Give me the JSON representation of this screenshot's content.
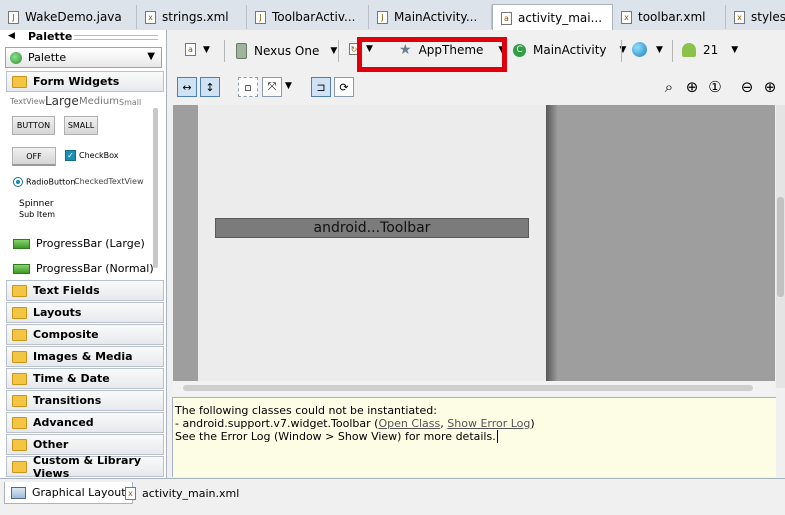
{
  "editor_tabs": [
    {
      "label": "WakeDemo.java",
      "icon": "java-file-icon"
    },
    {
      "label": "strings.xml",
      "icon": "xml-file-icon"
    },
    {
      "label": "ToolbarActiv...",
      "icon": "java-file-icon"
    },
    {
      "label": "MainActivity...",
      "icon": "java-file-icon"
    },
    {
      "label": "activity_mai...",
      "icon": "layout-file-icon",
      "active": true
    },
    {
      "label": "toolbar.xml",
      "icon": "xml-file-icon"
    },
    {
      "label": "styles.xm",
      "icon": "xml-file-icon"
    }
  ],
  "palette": {
    "header": "Palette",
    "selector": "Palette",
    "categories": {
      "form_widgets": "Form Widgets",
      "text_fields": "Text Fields",
      "layouts": "Layouts",
      "composite": "Composite",
      "images_media": "Images & Media",
      "time_date": "Time & Date",
      "transitions": "Transitions",
      "advanced": "Advanced",
      "other": "Other",
      "custom": "Custom & Library Views"
    },
    "widgets": {
      "textview": "TextView",
      "large": "Large",
      "medium": "Medium",
      "small_text": "Small",
      "button": "BUTTON",
      "small_button": "SMALL",
      "toggle_off": "OFF",
      "checkbox": "CheckBox",
      "radiobutton": "RadioButton",
      "checkedtextview": "CheckedTextView",
      "spinner": "Spinner",
      "sub_item": "Sub Item",
      "progress_large": "ProgressBar (Large)",
      "progress_normal": "ProgressBar (Normal)"
    }
  },
  "toolbar": {
    "device": "Nexus One",
    "theme": "AppTheme",
    "activity": "MainActivity",
    "api_level": "21"
  },
  "canvas": {
    "toolbar_widget_label": "android...Toolbar"
  },
  "errors": {
    "line1": "The following classes could not be instantiated:",
    "line2_prefix": "- android.support.v7.widget.Toolbar (",
    "open_class": "Open Class",
    "comma": ", ",
    "show_error_log": "Show Error Log",
    "line2_suffix": ")",
    "line3": "See the Error Log (Window > Show View) for more details."
  },
  "bottom_tabs": {
    "graphical": "Graphical Layout",
    "xml": "activity_main.xml"
  },
  "colors": {
    "highlight": "#e0000b",
    "error_panel_bg": "#fdfde6"
  }
}
